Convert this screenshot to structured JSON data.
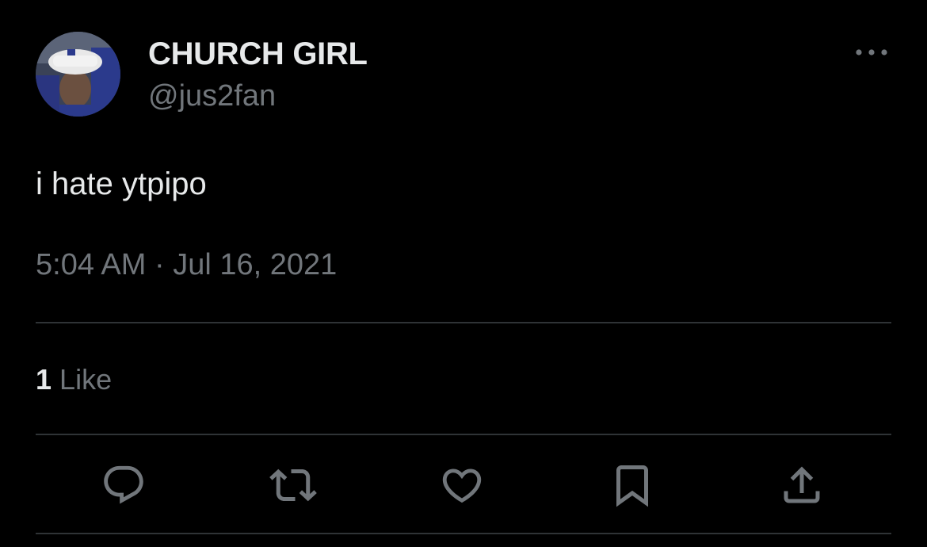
{
  "author": {
    "display_name": "CHURCH GIRL",
    "handle": "@jus2fan"
  },
  "tweet": {
    "text": "i hate ytpipo",
    "time": "5:04 AM",
    "separator": "·",
    "date": "Jul 16, 2021"
  },
  "stats": {
    "likes_count": "1",
    "likes_label": "Like"
  },
  "icons": {
    "more": "more-horizontal-icon",
    "reply": "reply-icon",
    "retweet": "retweet-icon",
    "like": "heart-icon",
    "bookmark": "bookmark-icon",
    "share": "share-icon"
  },
  "colors": {
    "background": "#000000",
    "primary_text": "#e7e9ea",
    "secondary_text": "#71767b",
    "divider": "#2f3336"
  }
}
